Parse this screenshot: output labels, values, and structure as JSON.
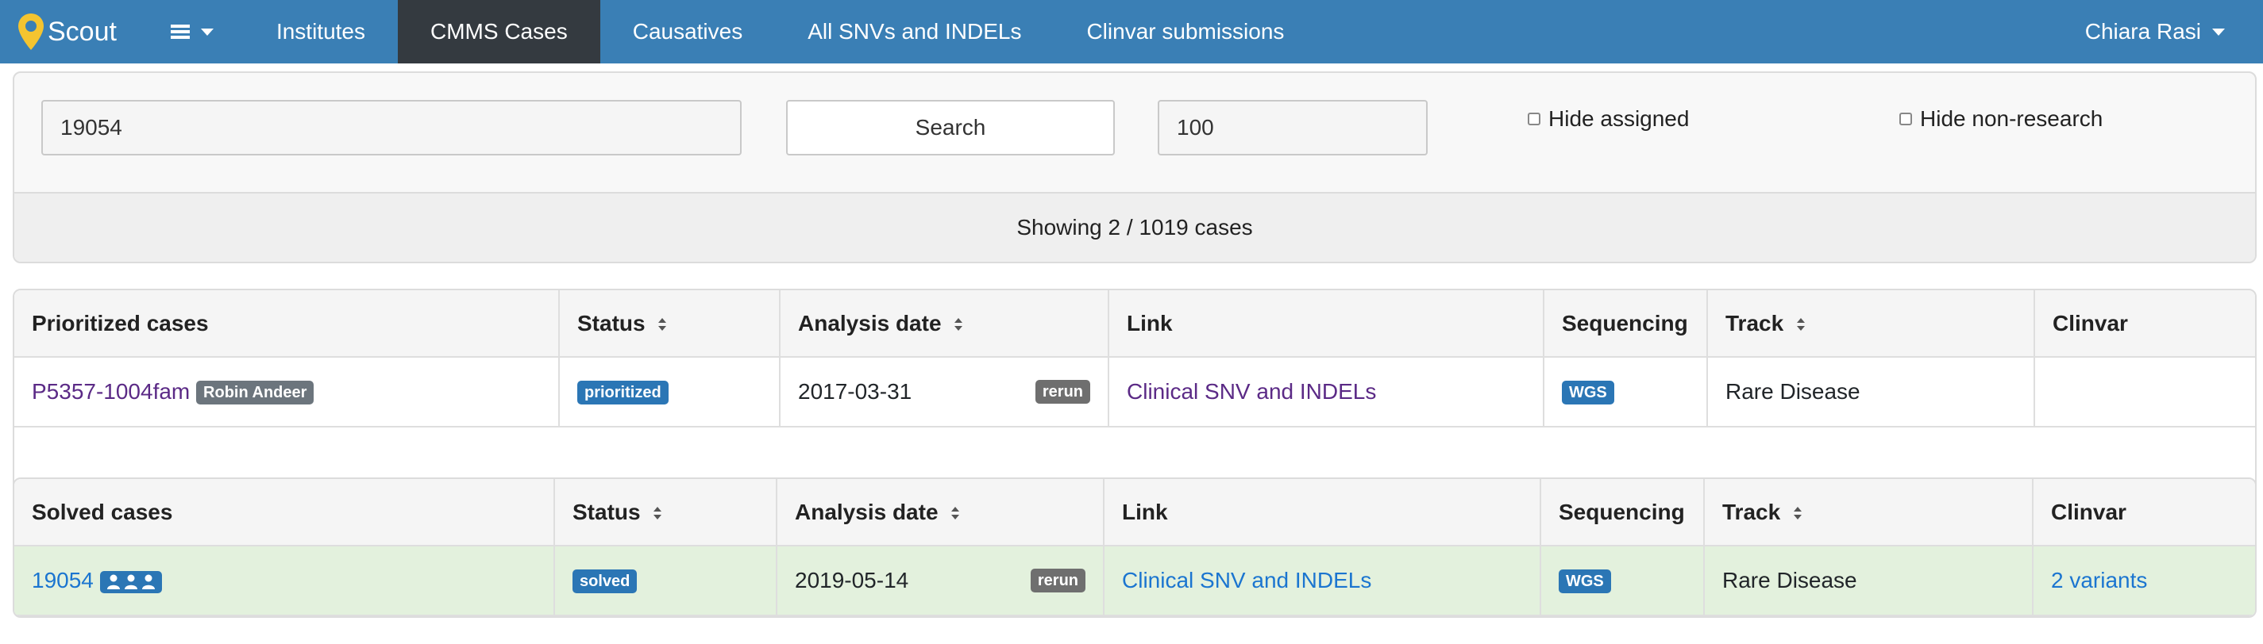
{
  "navbar": {
    "brand": "Scout",
    "links": [
      "Institutes",
      "CMMS Cases",
      "Causatives",
      "All SNVs and INDELs",
      "Clinvar submissions"
    ],
    "active_index": 1,
    "user": "Chiara Rasi",
    "color": "#3a7fb5"
  },
  "filters": {
    "query_value": "19054",
    "search_label": "Search",
    "limit_value": "100",
    "hide_assigned_label": "Hide assigned",
    "hide_assigned_checked": false,
    "hide_nonresearch_label": "Hide non-research",
    "hide_nonresearch_checked": false,
    "showing_text": "Showing 2 / 1019 cases"
  },
  "prioritized_table": {
    "headers": [
      "Prioritized cases",
      "Status",
      "Analysis date",
      "Link",
      "Sequencing",
      "Track",
      "Clinvar"
    ],
    "rows": [
      {
        "case_name": "P5357-1004fam",
        "assignee": "Robin Andeer",
        "status": "prioritized",
        "analysis_date": "2017-03-31",
        "rerun": "rerun",
        "link": "Clinical SNV and INDELs",
        "sequencing": "WGS",
        "track": "Rare Disease",
        "clinvar": ""
      }
    ]
  },
  "solved_table": {
    "headers": [
      "Solved cases",
      "Status",
      "Analysis date",
      "Link",
      "Sequencing",
      "Track",
      "Clinvar"
    ],
    "rows": [
      {
        "case_name": "19054",
        "individuals_icon": "users-icon",
        "status": "solved",
        "analysis_date": "2019-05-14",
        "rerun": "rerun",
        "link": "Clinical SNV and INDELs",
        "sequencing": "WGS",
        "track": "Rare Disease",
        "clinvar": "2 variants"
      }
    ]
  },
  "colors": {
    "status_badge": "#2b76b5",
    "solved_row": "#e3f1dd",
    "link_visited": "#5b2a86",
    "link": "#1b75d0"
  }
}
